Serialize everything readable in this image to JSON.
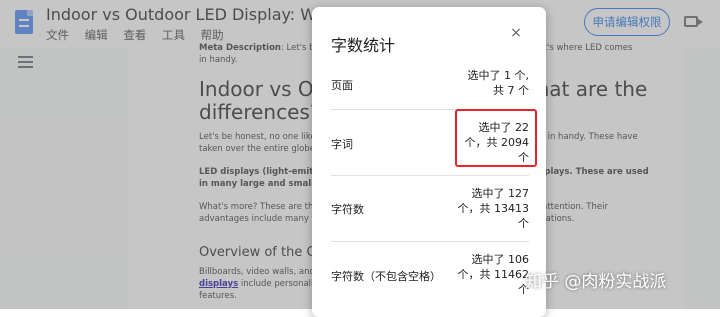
{
  "doc": {
    "title": "Indoor vs Outdoor LED Display: What are the",
    "menu": [
      "文件",
      "编辑",
      "查看",
      "工具",
      "帮助"
    ],
    "share_label": "申请编辑权限"
  },
  "page": {
    "meta_label": "Meta Description",
    "meta_text": ": Let's be honest, no one likes a boring display board, and that's where LED comes in handy.",
    "heading": "Indoor vs Outdoor LED Display: What are the differences?",
    "para1": "Let's be honest, no one likes a boring display board, and that's where LED comes in handy. These have taken over the entire globe.",
    "para2": "LED displays (light-emitting diodes) are indoor displays and outdoor displays. These are used in many large and small places.",
    "para3": "What's more? These are the displays for attracting customers and keeping their attention. Their advantages include many features and their overall superiority to previous generations.",
    "heading2": "Overview of the Global LED display market scenarios",
    "para4_a": "Billboards, video walls, and other LED",
    "para4_link": "displays",
    "para4_b": "include personalized",
    "para4_c": "features."
  },
  "dialog": {
    "title": "字数统计",
    "close": "×",
    "rows": [
      {
        "label": "页面",
        "value_lines": [
          "选中了 1 个,",
          "共 7 个"
        ]
      },
      {
        "label": "字词",
        "value_lines": [
          "选中了 22",
          "个，共 2094",
          "个"
        ]
      },
      {
        "label": "字符数",
        "value_lines": [
          "选中了 127",
          "个，共 13413",
          "个"
        ]
      },
      {
        "label": "字符数（不包含空格）",
        "value_lines": [
          "选中了 106",
          "个，共 11462",
          "个"
        ]
      }
    ]
  },
  "watermark": {
    "text": "知乎 @肉粉实战派"
  },
  "colors": {
    "accent": "#1a73e8",
    "highlight": "#e8242c"
  }
}
